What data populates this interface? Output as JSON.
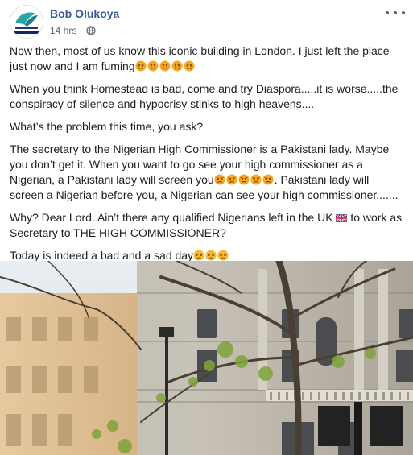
{
  "post": {
    "author": "Bob Olukoya",
    "time": "14 hrs",
    "dot": "·",
    "paragraphs": [
      {
        "text": "Now then, most of us know this iconic building in London. I just left the place just now and I am fuming",
        "emoji": "angry",
        "emoji_count": 5
      },
      {
        "text": "When you think Homestead is bad, come and try Diaspora.....it is worse.....the conspiracy of silence and hypocrisy stinks to high heavens....",
        "emoji": "",
        "emoji_count": 0
      },
      {
        "text": "What’s the problem this time, you ask?",
        "emoji": "",
        "emoji_count": 0
      }
    ],
    "p4_a": "The secretary to the Nigerian High Commissioner is a Pakistani lady. Maybe you don’t get it. When you want to go see your high commissioner as a Nigerian, a Pakistani lady will screen you",
    "p4_b": ". Pakistani lady will screen a Nigerian before you, a Nigerian can see your high commissioner.......",
    "p5_a": "Why? Dear Lord. Ain’t there any qualified Nigerians left in the UK ",
    "p5_b": " to work as Secretary to THE HIGH COMMISSIONER?",
    "p6": "Today is indeed a bad and a sad day",
    "emoji_angry_name": "angry-face",
    "emoji_sad_name": "persevering-face",
    "flag_name": "uk-flag"
  },
  "colors": {
    "author": "#385898",
    "meta": "#616770",
    "text": "#1c1e21",
    "emoji_face": "#f7b733",
    "emoji_angry_face": "#f5a623"
  }
}
